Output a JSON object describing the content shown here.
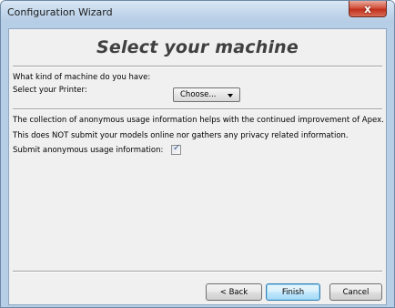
{
  "window": {
    "title": "Configuration Wizard",
    "close_glyph": "x"
  },
  "page": {
    "heading": "Select your machine",
    "machine_question": "What kind of machine do you have:",
    "printer_label": "Select your Printer:",
    "printer_select_value": "Choose...",
    "usage_line1": "The collection of anonymous usage information helps with the continued improvement of Apex.",
    "usage_line2": "This does NOT submit your models online nor gathers any privacy related information.",
    "submit_usage_label": "Submit anonymous usage information:",
    "submit_usage_checked": true,
    "check_glyph": "✓"
  },
  "buttons": {
    "back": "< Back",
    "finish": "Finish",
    "cancel": "Cancel"
  },
  "icons": {
    "close": "close-icon",
    "dropdown": "chevron-down-icon",
    "check": "checkmark-icon"
  },
  "colors": {
    "heading": "#404040",
    "default_button_border": "#3c7fb1",
    "close_button": "#c0301c"
  }
}
